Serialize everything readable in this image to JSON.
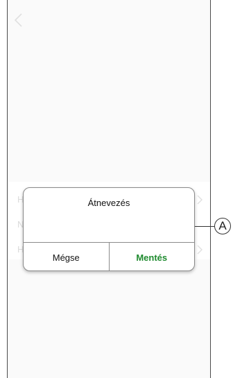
{
  "dialog": {
    "title": "Átnevezés",
    "input_value": "",
    "cancel_label": "Mégse",
    "save_label": "Mentés"
  },
  "background_rows": [
    {
      "initial": "H"
    },
    {
      "initial": "N"
    },
    {
      "initial": "H"
    }
  ],
  "callout": {
    "label": "A"
  },
  "icons": {
    "back": "chevron-left-icon",
    "row": "chevron-right-icon"
  },
  "colors": {
    "accent": "#1e8a2e",
    "frame": "#4a4a4a"
  }
}
